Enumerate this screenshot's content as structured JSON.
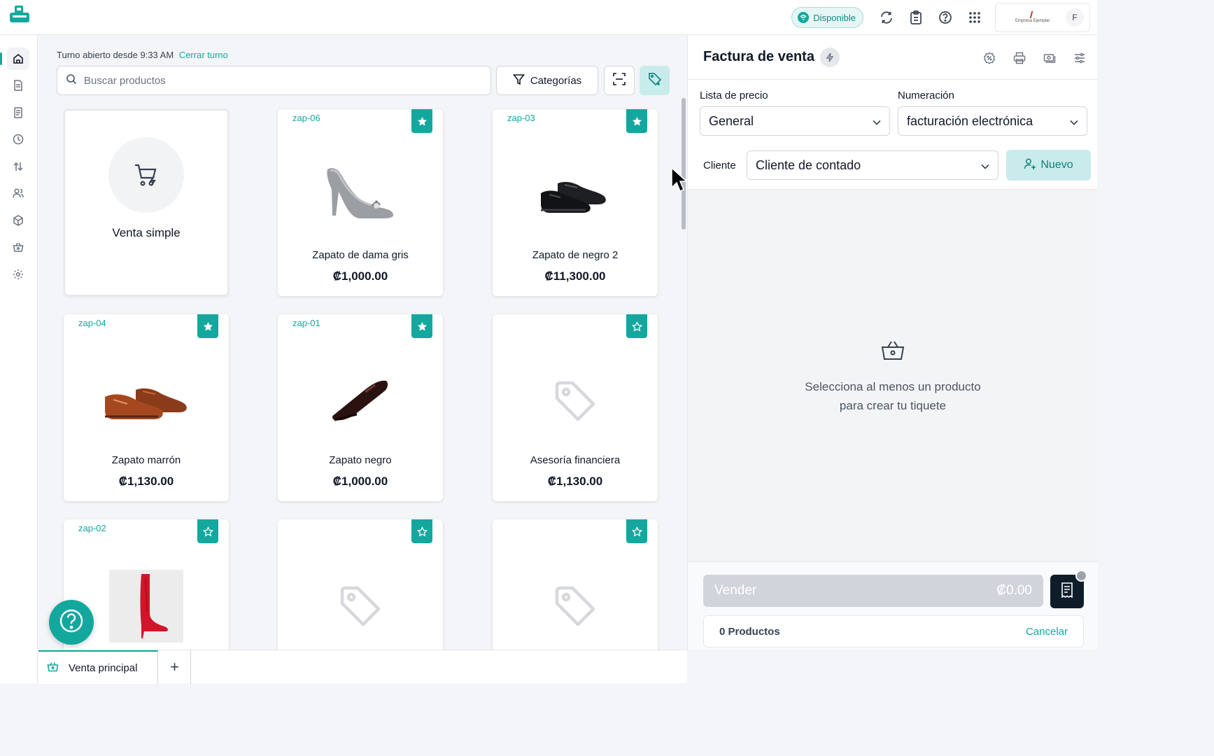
{
  "topbar": {
    "status": "Disponible",
    "icons": [
      "sync-icon",
      "clipboard-icon",
      "help-icon",
      "apps-grid-icon"
    ],
    "company_logo_text": "Empresa Ejemplar",
    "avatar": "F"
  },
  "sidebar": {
    "items": [
      "home-icon",
      "document-icon",
      "receipt-icon",
      "clock-icon",
      "transfer-icon",
      "users-icon",
      "box-icon",
      "basket-icon",
      "settings-icon"
    ],
    "active": "home-icon"
  },
  "catalog": {
    "shift_text": "Turno abierto desde 9:33 AM",
    "close_shift": "Cerrar turno",
    "search_placeholder": "Buscar productos",
    "categories_label": "Categorías",
    "simple_sale": "Venta simple",
    "products": [
      {
        "ref": "zap-06",
        "name": "Zapato de dama gris",
        "price": "₡1,000.00",
        "favorite": true,
        "image": "gray-heel-shoe"
      },
      {
        "ref": "zap-03",
        "name": "Zapato de negro 2",
        "price": "₡11,300.00",
        "favorite": true,
        "image": "black-derby-shoes"
      },
      {
        "ref": "zap-04",
        "name": "Zapato marrón",
        "price": "₡1,130.00",
        "favorite": true,
        "image": "brown-brogue-shoes"
      },
      {
        "ref": "zap-01",
        "name": "Zapato negro",
        "price": "₡1,000.00",
        "favorite": true,
        "image": "black-loafer-shoe"
      },
      {
        "ref": "",
        "name": "Asesoría financiera",
        "price": "₡1,130.00",
        "favorite": false,
        "image": "tag-placeholder"
      },
      {
        "ref": "zap-02",
        "name": "",
        "price": "",
        "favorite": false,
        "image": "red-boot"
      },
      {
        "ref": "",
        "name": "",
        "price": "",
        "favorite": false,
        "image": "tag-placeholder"
      },
      {
        "ref": "",
        "name": "",
        "price": "",
        "favorite": false,
        "image": "tag-placeholder"
      }
    ]
  },
  "tabs": {
    "main": "Venta principal",
    "add": "+"
  },
  "invoice": {
    "title": "Factura de venta",
    "price_list_label": "Lista de precio",
    "price_list_value": "General",
    "numbering_label": "Numeración",
    "numbering_value": "facturación electrónica",
    "client_label": "Cliente",
    "client_value": "Cliente de contado",
    "new_client": "Nuevo",
    "empty_line1": "Selecciona al menos un producto",
    "empty_line2": "para crear tu tiquete",
    "sell_label": "Vender",
    "sell_total": "₡0.00",
    "products_count": "0 Productos",
    "cancel": "Cancelar"
  },
  "colors": {
    "accent": "#13a89e",
    "accent_light": "#c8eceb",
    "background": "#f4f5f8"
  }
}
